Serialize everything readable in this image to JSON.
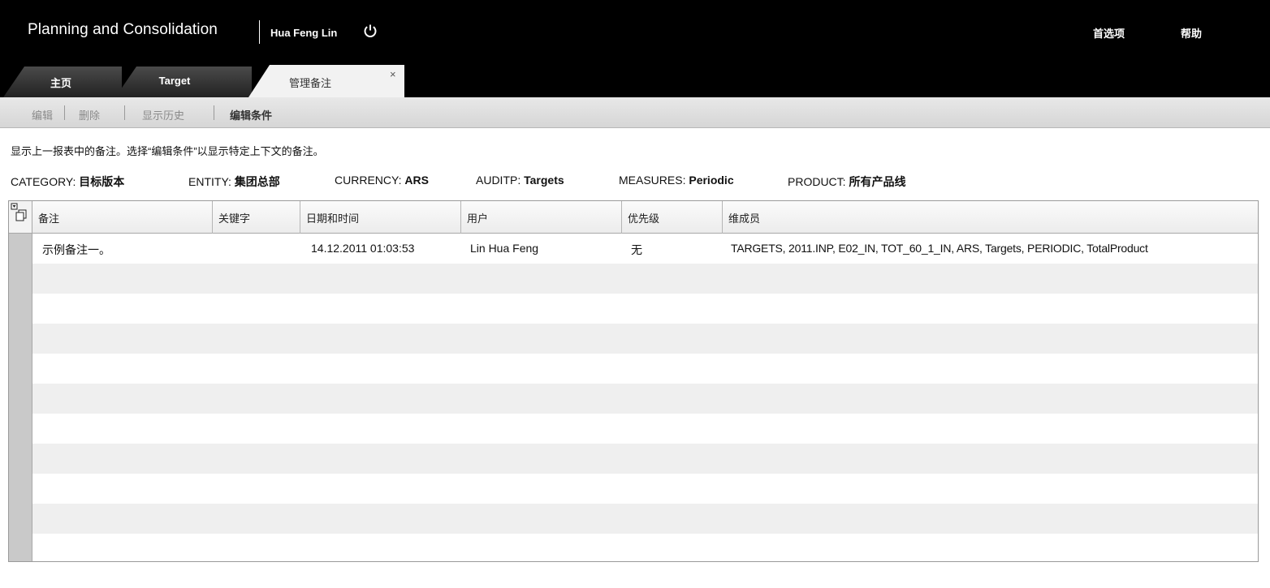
{
  "header": {
    "app_title": "Planning and Consolidation",
    "user_name": "Hua Feng Lin",
    "preferences_label": "首选项",
    "help_label": "帮助"
  },
  "tabs": [
    {
      "label": "主页",
      "active": false
    },
    {
      "label": "Target",
      "active": false
    },
    {
      "label": "管理备注",
      "active": true,
      "close": "×"
    }
  ],
  "toolbar": {
    "edit": "编辑",
    "delete": "删除",
    "show_history": "显示历史",
    "edit_criteria": "编辑条件"
  },
  "description": "显示上一报表中的备注。选择“编辑条件”以显示特定上下文的备注。",
  "context": [
    {
      "key": "CATEGORY:",
      "value": "目标版本"
    },
    {
      "key": "ENTITY:",
      "value": "集团总部"
    },
    {
      "key": "CURRENCY:",
      "value": "ARS"
    },
    {
      "key": "AUDITP:",
      "value": "Targets"
    },
    {
      "key": "MEASURES:",
      "value": "Periodic"
    },
    {
      "key": "PRODUCT:",
      "value": "所有产品线"
    }
  ],
  "grid": {
    "columns": [
      "备注",
      "关键字",
      "日期和时间",
      "用户",
      "优先级",
      "维成员"
    ],
    "rows": [
      [
        "示例备注一。",
        "",
        "14.12.2011 01:03:53",
        "Lin Hua Feng",
        "无",
        "TARGETS, 2011.INP, E02_IN, TOT_60_1_IN, ARS, Targets, PERIODIC, TotalProduct"
      ]
    ]
  }
}
